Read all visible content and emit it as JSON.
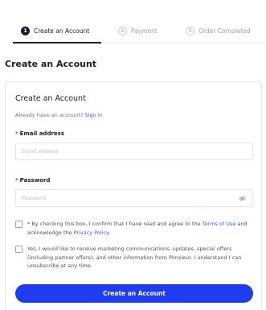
{
  "steps": [
    {
      "number": "1",
      "label": "Create an Account",
      "active": true
    },
    {
      "number": "2",
      "label": "Payment",
      "active": false
    },
    {
      "number": "3",
      "label": "Order Completed",
      "active": false
    }
  ],
  "page_title": "Create an Account",
  "card": {
    "title": "Create an Account",
    "signin_prefix": "Already have an account?",
    "signin_link": "Sign in",
    "email": {
      "required_mark": "*",
      "label": "Email address",
      "placeholder": "Email address",
      "value": ""
    },
    "password": {
      "required_mark": "*",
      "label": "Password",
      "placeholder": "Password",
      "value": ""
    },
    "terms": {
      "text_before": "* By checking this box, I confirm that I have read and agree to the",
      "terms_link": "Terms of Use",
      "text_middle": "and acknowledge the",
      "privacy_link": "Privacy Policy",
      "text_end": ".",
      "checked": false
    },
    "marketing": {
      "text": "Yes, I would like to receive marketing communications, updates, special offers (including partner offers), and other information from Pimsleur. I understand I can unsubscribe at any time.",
      "checked": false
    },
    "submit_label": "Create an Account"
  },
  "colors": {
    "accent": "#1f3cf0",
    "link": "#2f5cff",
    "text": "#1a1d2e"
  }
}
